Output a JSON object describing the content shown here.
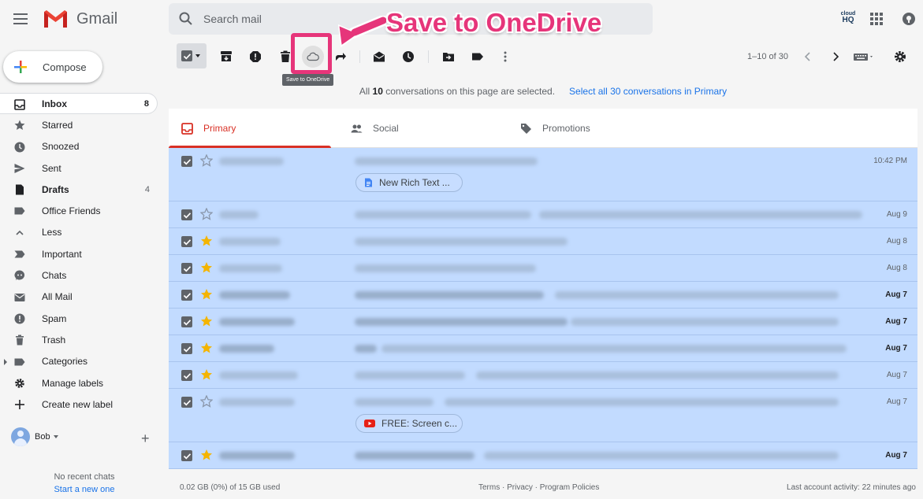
{
  "header": {
    "app_name": "Gmail",
    "search_placeholder": "Search mail",
    "cloudhq_top": "cloud",
    "cloudhq_bottom": "HQ"
  },
  "sidebar": {
    "compose_label": "Compose",
    "items": [
      {
        "label": "Inbox",
        "count": "8",
        "icon": "inbox-icon",
        "active": true
      },
      {
        "label": "Starred",
        "count": "",
        "icon": "star-icon"
      },
      {
        "label": "Snoozed",
        "count": "",
        "icon": "clock-icon"
      },
      {
        "label": "Sent",
        "count": "",
        "icon": "send-icon"
      },
      {
        "label": "Drafts",
        "count": "4",
        "icon": "draft-icon"
      },
      {
        "label": "Office Friends",
        "count": "",
        "icon": "label-icon"
      },
      {
        "label": "Less",
        "count": "",
        "icon": "chevron-up-icon"
      },
      {
        "label": "Important",
        "count": "",
        "icon": "important-icon"
      },
      {
        "label": "Chats",
        "count": "",
        "icon": "chat-icon"
      },
      {
        "label": "All Mail",
        "count": "",
        "icon": "mail-icon"
      },
      {
        "label": "Spam",
        "count": "",
        "icon": "spam-icon"
      },
      {
        "label": "Trash",
        "count": "",
        "icon": "trash-icon"
      },
      {
        "label": "Categories",
        "count": "",
        "icon": "label-icon"
      },
      {
        "label": "Manage labels",
        "count": "",
        "icon": "gear-icon"
      },
      {
        "label": "Create new label",
        "count": "",
        "icon": "plus-icon"
      }
    ],
    "user_name": "Bob",
    "no_chats": "No recent chats",
    "start_chat": "Start a new one"
  },
  "toolbar": {
    "tooltip": "Save to OneDrive",
    "pager": "1–10 of 30",
    "annotation": "Save to OneDrive"
  },
  "banner": {
    "text_pre": "All",
    "count": "10",
    "text_post": "conversations on this page are selected.",
    "select_all": "Select all 30 conversations in Primary"
  },
  "tabs": [
    {
      "label": "Primary",
      "active": true
    },
    {
      "label": "Social"
    },
    {
      "label": "Promotions"
    }
  ],
  "emails": [
    {
      "date": "10:42 PM",
      "bold": false,
      "starred": false,
      "chip": "New Rich Text ..."
    },
    {
      "date": "Aug 9",
      "bold": false,
      "starred": false
    },
    {
      "date": "Aug 8",
      "bold": false,
      "starred": true
    },
    {
      "date": "Aug 8",
      "bold": false,
      "starred": true
    },
    {
      "date": "Aug 7",
      "bold": true,
      "starred": true
    },
    {
      "date": "Aug 7",
      "bold": true,
      "starred": true
    },
    {
      "date": "Aug 7",
      "bold": true,
      "starred": true
    },
    {
      "date": "Aug 7",
      "bold": false,
      "starred": true
    },
    {
      "date": "Aug 7",
      "bold": false,
      "starred": false,
      "chip": "FREE: Screen c..."
    },
    {
      "date": "Aug 7",
      "bold": true,
      "starred": true
    }
  ],
  "footer": {
    "storage": "0.02 GB (0%) of 15 GB used",
    "links": "Terms · Privacy · Program Policies",
    "activity": "Last account activity: 22 minutes ago"
  },
  "colors": {
    "selected_row": "#c2dbff",
    "accent_red": "#d93025",
    "link_blue": "#1a73e8",
    "annotation_pink": "#e6357a"
  }
}
